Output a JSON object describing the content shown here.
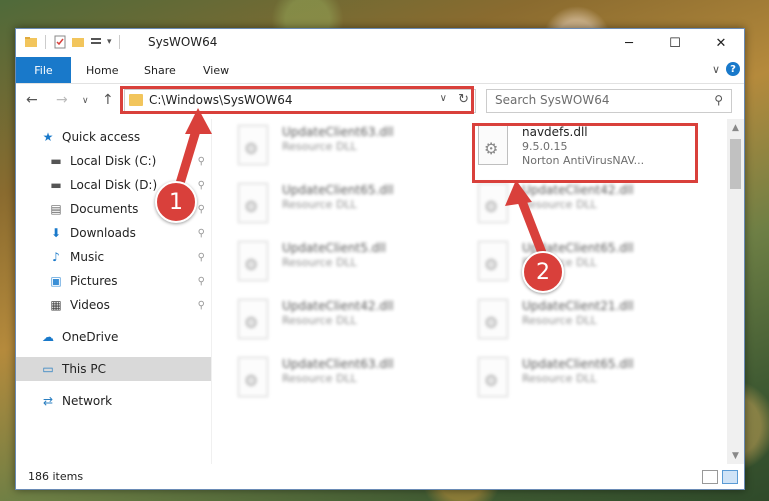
{
  "window": {
    "title": "SysWOW64",
    "controls": {
      "minimize": "─",
      "maximize": "☐",
      "close": "✕"
    }
  },
  "ribbon": {
    "file_tab": "File",
    "tabs": [
      "Home",
      "Share",
      "View"
    ],
    "expand_glyph": "∨",
    "help_glyph": "?"
  },
  "nav": {
    "back": "←",
    "forward": "→",
    "recent": "∨",
    "up": "↑",
    "address": "C:\\Windows\\SysWOW64",
    "address_dropdown": "∨",
    "refresh": "↻",
    "search_placeholder": "Search SysWOW64",
    "search_glyph": "🔍"
  },
  "sidebar": {
    "items": [
      {
        "label": "Quick access",
        "icon": "star-icon",
        "glyph": "★",
        "color": "#1979ca"
      },
      {
        "label": "Local Disk (C:)",
        "icon": "drive-icon",
        "glyph": "▬",
        "pinned": true
      },
      {
        "label": "Local Disk (D:)",
        "icon": "drive-icon",
        "glyph": "▬",
        "pinned": true
      },
      {
        "label": "Documents",
        "icon": "documents-icon",
        "glyph": "▤",
        "pinned": true
      },
      {
        "label": "Downloads",
        "icon": "download-icon",
        "glyph": "⬇",
        "color": "#1979ca",
        "pinned": true
      },
      {
        "label": "Music",
        "icon": "music-icon",
        "glyph": "♪",
        "color": "#1979ca",
        "pinned": true
      },
      {
        "label": "Pictures",
        "icon": "pictures-icon",
        "glyph": "▣",
        "color": "#3a8fd6",
        "pinned": true
      },
      {
        "label": "Videos",
        "icon": "videos-icon",
        "glyph": "▦",
        "pinned": true
      },
      {
        "label": "OneDrive",
        "icon": "cloud-icon",
        "glyph": "☁",
        "color": "#1979ca"
      },
      {
        "label": "This PC",
        "icon": "computer-icon",
        "glyph": "▭",
        "color": "#2a7fc1",
        "selected": true
      },
      {
        "label": "Network",
        "icon": "network-icon",
        "glyph": "⇄",
        "color": "#2a7fc1"
      }
    ],
    "pin_glyph": "📌"
  },
  "files": {
    "left": [
      {
        "name": "UpdateClient63.dll",
        "type": "Resource DLL"
      },
      {
        "name": "UpdateClient65.dll",
        "type": "Resource DLL"
      },
      {
        "name": "UpdateClient5.dll",
        "type": "Resource DLL"
      },
      {
        "name": "UpdateClient42.dll",
        "type": "Resource DLL"
      },
      {
        "name": "UpdateClient63.dll",
        "type": "Resource DLL"
      }
    ],
    "right": [
      {
        "name": "navdefs.dll",
        "version": "9.5.0.15",
        "company": "Norton AntiVirusNAV...",
        "highlighted": true
      },
      {
        "name": "UpdateClient42.dll",
        "type": "Resource DLL"
      },
      {
        "name": "UpdateClient65.dll",
        "type": "Resource DLL"
      },
      {
        "name": "UpdateClient21.dll",
        "type": "Resource DLL"
      },
      {
        "name": "UpdateClient65.dll",
        "type": "Resource DLL"
      }
    ]
  },
  "status": {
    "item_count": "186 items"
  },
  "callouts": {
    "one": "1",
    "two": "2"
  },
  "colors": {
    "accent": "#1979ca",
    "highlight": "#d9403b"
  }
}
